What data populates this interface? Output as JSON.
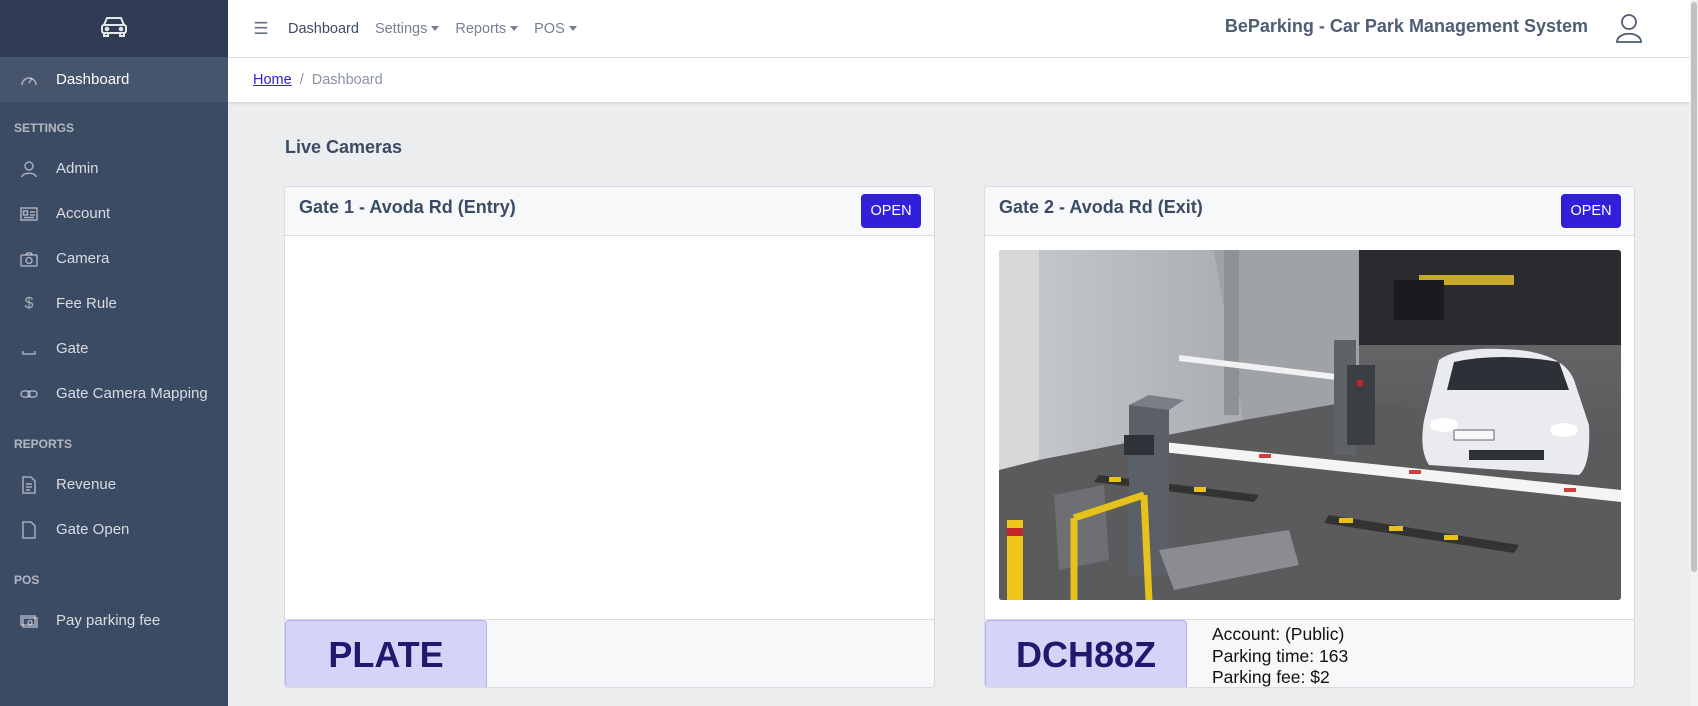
{
  "sidebar": {
    "brand_icon": "car-icon",
    "dashboard": "Dashboard",
    "settings_title": "SETTINGS",
    "settings_items": [
      {
        "label": "Admin",
        "icon": "user-icon"
      },
      {
        "label": "Account",
        "icon": "id-card-icon"
      },
      {
        "label": "Camera",
        "icon": "camera-icon"
      },
      {
        "label": "Fee Rule",
        "icon": "dollar-icon"
      },
      {
        "label": "Gate",
        "icon": "space-bar-icon"
      },
      {
        "label": "Gate Camera Mapping",
        "icon": "link-icon"
      }
    ],
    "reports_title": "REPORTS",
    "reports_items": [
      {
        "label": "Revenue",
        "icon": "document-icon"
      },
      {
        "label": "Gate Open",
        "icon": "file-icon"
      }
    ],
    "pos_title": "POS",
    "pos_items": [
      {
        "label": "Pay parking fee",
        "icon": "money-icon"
      }
    ]
  },
  "header": {
    "nav": {
      "dashboard": "Dashboard",
      "settings": "Settings",
      "reports": "Reports",
      "pos": "POS"
    },
    "app_title": "BeParking - Car Park Management System"
  },
  "breadcrumb": {
    "home": "Home",
    "separator": "/",
    "current": "Dashboard"
  },
  "main": {
    "heading": "Live Cameras",
    "cameras": [
      {
        "title": "Gate 1 - Avoda Rd (Entry)",
        "button": "OPEN",
        "plate": "PLATE"
      },
      {
        "title": "Gate 2 - Avoda Rd (Exit)",
        "button": "OPEN",
        "plate": "DCH88Z",
        "info": {
          "account": "Account: (Public)",
          "parking_time": "Parking time: 163",
          "parking_fee": "Parking fee: $2"
        }
      }
    ]
  },
  "colors": {
    "sidebar_bg": "#3c4b64",
    "primary": "#321fdb",
    "plate_bg": "#d5d3f7"
  }
}
